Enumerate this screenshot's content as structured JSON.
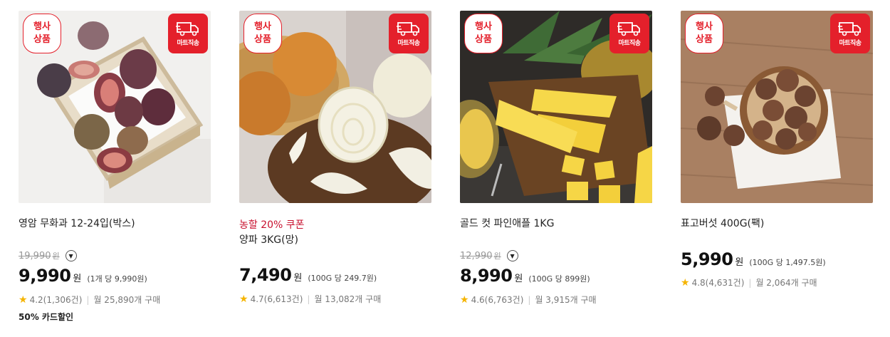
{
  "products": [
    {
      "badge_event": [
        "행사",
        "상품"
      ],
      "badge_delivery": "마트직송",
      "coupon": "",
      "title": "영암 무화과 12-24입(박스)",
      "original_price": "19,990",
      "original_won": "원",
      "price": "9,990",
      "won": "원",
      "unit_price": "(1개 당 9,990원)",
      "rating": "4.2(1,306건)",
      "monthly": "월 25,890개 구매",
      "card_discount": "50% 카드할인"
    },
    {
      "badge_event": [
        "행사",
        "상품"
      ],
      "badge_delivery": "마트직송",
      "coupon": "농할 20% 쿠폰",
      "title": "양파 3KG(망)",
      "original_price": "",
      "original_won": "",
      "price": "7,490",
      "won": "원",
      "unit_price": "(100G 당 249.7원)",
      "rating": "4.7(6,613건)",
      "monthly": "월 13,082개 구매",
      "card_discount": ""
    },
    {
      "badge_event": [
        "행사",
        "상품"
      ],
      "badge_delivery": "마트직송",
      "coupon": "",
      "title": "골드 컷 파인애플 1KG",
      "original_price": "12,990",
      "original_won": "원",
      "price": "8,990",
      "won": "원",
      "unit_price": "(100G 당 899원)",
      "rating": "4.6(6,763건)",
      "monthly": "월 3,915개 구매",
      "card_discount": ""
    },
    {
      "badge_event": [
        "행사",
        "상품"
      ],
      "badge_delivery": "마트직송",
      "coupon": "",
      "title": "표고버섯 400G(팩)",
      "original_price": "",
      "original_won": "",
      "price": "5,990",
      "won": "원",
      "unit_price": "(100G 당 1,497.5원)",
      "rating": "4.8(4,631건)",
      "monthly": "월 2,064개 구매",
      "card_discount": ""
    }
  ],
  "colors": {
    "accent_red": "#e4202b",
    "coupon_red": "#c8102e",
    "star": "#f5b400"
  },
  "icons": {
    "delivery": "truck-icon",
    "dropdown": "chevron-down-icon",
    "rating": "star-icon"
  }
}
